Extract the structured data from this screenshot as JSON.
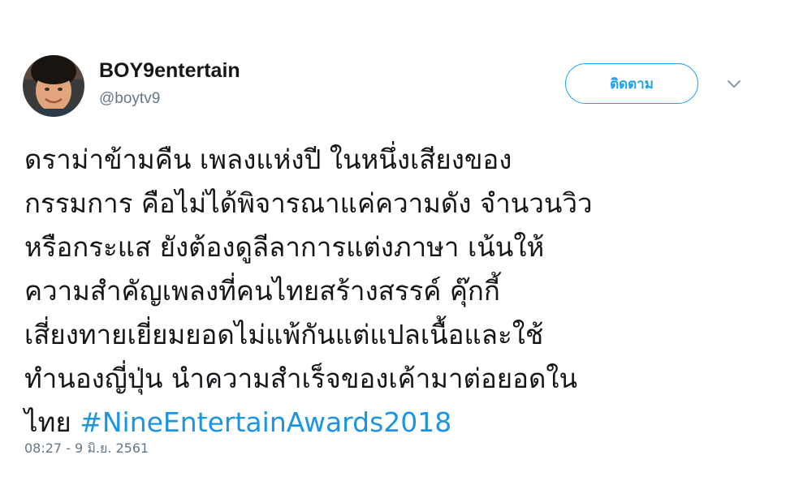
{
  "user": {
    "display_name": "BOY9entertain",
    "handle": "@boytv9",
    "avatar_icon": "profile-photo"
  },
  "actions": {
    "follow_label": "ติดตาม",
    "menu_icon": "chevron-down-icon"
  },
  "tweet": {
    "lines": [
      "ดราม่าข้ามคืน เพลงแห่งปี ในหนึ่งเสียงของ",
      "กรรมการ คือไม่ได้พิจารณาแค่ความดัง จำนวนวิว",
      "หรือกระแส ยังต้องดูลีลาการแต่งภาษา เน้นให้",
      "ความสำคัญเพลงที่คนไทยสร้างสรรค์ คุ๊กกี้",
      "เสี่ยงทายเยี่ยมยอดไม่แพ้กันแต่แปลเนื้อและใช้",
      "ทำนองญี่ปุ่น นำความสำเร็จของเค้ามาต่อยอดใน"
    ],
    "last_line_prefix": "ไทย ",
    "hashtag": "#NineEntertainAwards2018",
    "timestamp": "08:27 - 9 มิ.ย. 2561"
  },
  "colors": {
    "accent": "#1da1f2",
    "hashtag": "#1b95e0",
    "muted": "#657786",
    "text": "#14171a"
  }
}
